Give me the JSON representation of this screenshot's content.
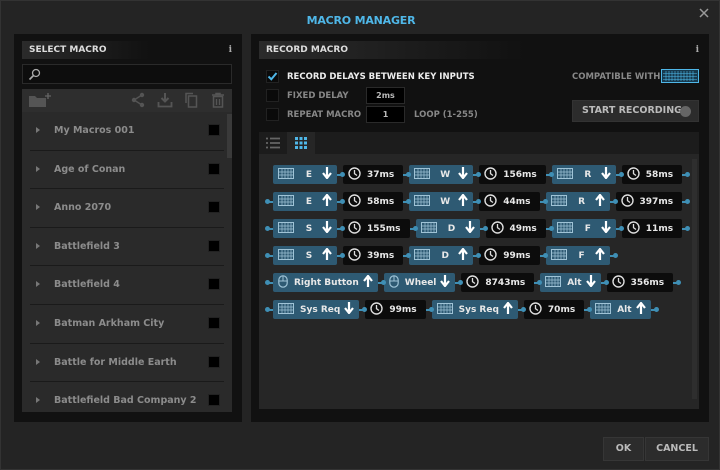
{
  "window": {
    "title": "MACRO MANAGER",
    "accent": "#4fb7e8"
  },
  "left": {
    "header": "SELECT MACRO",
    "info": "i",
    "search": {
      "placeholder": "",
      "value": ""
    },
    "toolbar": [
      "new-folder-icon",
      "share-icon",
      "download-icon",
      "copy-icon",
      "trash-icon"
    ],
    "macros": [
      "My Macros 001",
      "Age of Conan",
      "Anno 2070",
      "Battlefield 3",
      "Battlefield 4",
      "Batman Arkham City",
      "Battle for Middle Earth",
      "Battlefield Bad Company 2"
    ]
  },
  "right": {
    "header": "RECORD MACRO",
    "info": "i",
    "record_delays": {
      "label": "RECORD DELAYS BETWEEN KEY INPUTS",
      "checked": true
    },
    "fixed_delay": {
      "label": "FIXED DELAY",
      "checked": false,
      "value": "2ms"
    },
    "repeat_macro": {
      "label": "REPEAT MACRO",
      "checked": false,
      "value": "1",
      "hint": "LOOP (1-255)"
    },
    "compatible_label": "COMPATIBLE WITH:",
    "start_recording": "START RECORDING",
    "tabs": [
      {
        "icon": "list-icon",
        "active": false
      },
      {
        "icon": "grid-icon",
        "active": true
      }
    ],
    "sequence": [
      [
        {
          "t": "key",
          "dev": "keyboard",
          "label": "E",
          "dir": "down"
        },
        {
          "t": "delay",
          "ms": "37ms"
        },
        {
          "t": "key",
          "dev": "keyboard",
          "label": "W",
          "dir": "down"
        },
        {
          "t": "delay",
          "ms": "156ms"
        },
        {
          "t": "key",
          "dev": "keyboard",
          "label": "R",
          "dir": "down"
        },
        {
          "t": "delay",
          "ms": "58ms"
        }
      ],
      [
        {
          "t": "key",
          "dev": "keyboard",
          "label": "E",
          "dir": "up"
        },
        {
          "t": "delay",
          "ms": "58ms"
        },
        {
          "t": "key",
          "dev": "keyboard",
          "label": "W",
          "dir": "up"
        },
        {
          "t": "delay",
          "ms": "44ms"
        },
        {
          "t": "key",
          "dev": "keyboard",
          "label": "R",
          "dir": "up"
        },
        {
          "t": "delay",
          "ms": "397ms"
        }
      ],
      [
        {
          "t": "key",
          "dev": "keyboard",
          "label": "S",
          "dir": "down"
        },
        {
          "t": "delay",
          "ms": "155ms"
        },
        {
          "t": "key",
          "dev": "keyboard",
          "label": "D",
          "dir": "down"
        },
        {
          "t": "delay",
          "ms": "49ms"
        },
        {
          "t": "key",
          "dev": "keyboard",
          "label": "F",
          "dir": "down"
        },
        {
          "t": "delay",
          "ms": "11ms"
        }
      ],
      [
        {
          "t": "key",
          "dev": "keyboard",
          "label": "S",
          "dir": "up"
        },
        {
          "t": "delay",
          "ms": "39ms"
        },
        {
          "t": "key",
          "dev": "keyboard",
          "label": "D",
          "dir": "up"
        },
        {
          "t": "delay",
          "ms": "99ms"
        },
        {
          "t": "key",
          "dev": "keyboard",
          "label": "F",
          "dir": "up"
        }
      ],
      [
        {
          "t": "key",
          "dev": "mouse",
          "label": "Right Button",
          "dir": "up"
        },
        {
          "t": "key",
          "dev": "mouse",
          "label": "Wheel",
          "dir": "down"
        },
        {
          "t": "delay",
          "ms": "8743ms"
        },
        {
          "t": "key",
          "dev": "keyboard",
          "label": "Alt",
          "dir": "down"
        },
        {
          "t": "delay",
          "ms": "356ms"
        }
      ],
      [
        {
          "t": "key",
          "dev": "keyboard",
          "label": "Sys Req",
          "dir": "down"
        },
        {
          "t": "delay",
          "ms": "99ms"
        },
        {
          "t": "key",
          "dev": "keyboard",
          "label": "Sys Req",
          "dir": "up"
        },
        {
          "t": "delay",
          "ms": "70ms"
        },
        {
          "t": "key",
          "dev": "keyboard",
          "label": "Alt",
          "dir": "up"
        }
      ]
    ]
  },
  "footer": {
    "ok": "OK",
    "cancel": "CANCEL"
  }
}
